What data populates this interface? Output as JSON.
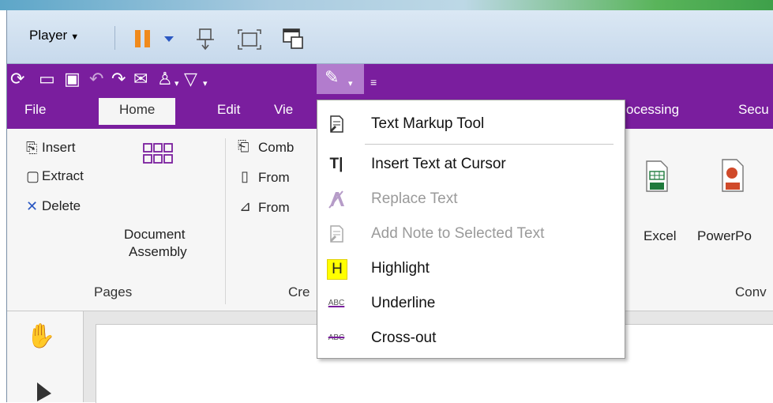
{
  "player": {
    "label": "Player"
  },
  "tabs": [
    {
      "label": "File"
    },
    {
      "label": "Home"
    },
    {
      "label": "Edit"
    },
    {
      "label": "Vie"
    },
    {
      "label": "ocessing"
    },
    {
      "label": "Secu"
    }
  ],
  "ribbon": {
    "pages_group": {
      "insert": "Insert",
      "extract": "Extract",
      "delete": "Delete",
      "document_assembly_line1": "Document",
      "document_assembly_line2": "Assembly",
      "label": "Pages"
    },
    "create_group": {
      "combine": "Comb",
      "from1": "From",
      "from2": "From",
      "label": "Cre"
    },
    "convert_group": {
      "excel": "Excel",
      "powerpoint": "PowerPo",
      "label": "Conv"
    }
  },
  "menu": {
    "items": [
      {
        "label": "Text Markup Tool",
        "enabled": true,
        "icon": "text-markup-icon"
      },
      {
        "label": "Insert Text at Cursor",
        "enabled": true,
        "icon": "insert-text-cursor-icon"
      },
      {
        "label": "Replace Text",
        "enabled": false,
        "icon": "replace-text-icon"
      },
      {
        "label": "Add Note to Selected Text",
        "enabled": false,
        "icon": "add-note-icon"
      },
      {
        "label": "Highlight",
        "enabled": true,
        "icon": "highlight-icon"
      },
      {
        "label": "Underline",
        "enabled": true,
        "icon": "underline-icon"
      },
      {
        "label": "Cross-out",
        "enabled": true,
        "icon": "cross-out-icon"
      }
    ],
    "glyphs": {
      "insert_text": "T|",
      "highlight": "H",
      "underline_abc": "ABC",
      "crossout_abc": "ABC"
    }
  },
  "colors": {
    "brand_purple": "#7a1e9e",
    "highlight_yellow": "#ffff00"
  }
}
